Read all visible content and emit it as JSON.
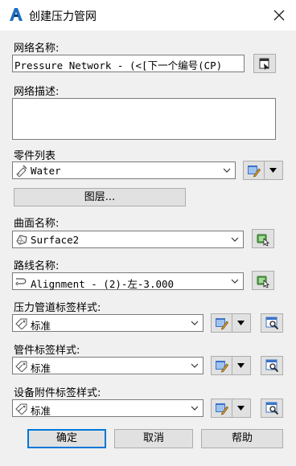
{
  "window": {
    "title": "创建压力管网"
  },
  "network_name": {
    "label": "网络名称:",
    "value": "Pressure Network - (<[下一个编号(CP)"
  },
  "network_desc": {
    "label": "网络描述:",
    "value": ""
  },
  "parts_list": {
    "label": "零件列表",
    "value": "Water"
  },
  "layers_button": {
    "label": "图层..."
  },
  "surface": {
    "label": "曲面名称:",
    "value": "Surface2"
  },
  "alignment": {
    "label": "路线名称:",
    "value": "Alignment - (2)-左-3.000"
  },
  "pipe_label_style": {
    "label": "压力管道标签样式:",
    "value": "标准"
  },
  "fitting_label_style": {
    "label": "管件标签样式:",
    "value": "标准"
  },
  "appurtenance_label_style": {
    "label": "设备附件标签样式:",
    "value": "标准"
  },
  "buttons": {
    "ok": "确定",
    "cancel": "取消",
    "help": "帮助"
  }
}
